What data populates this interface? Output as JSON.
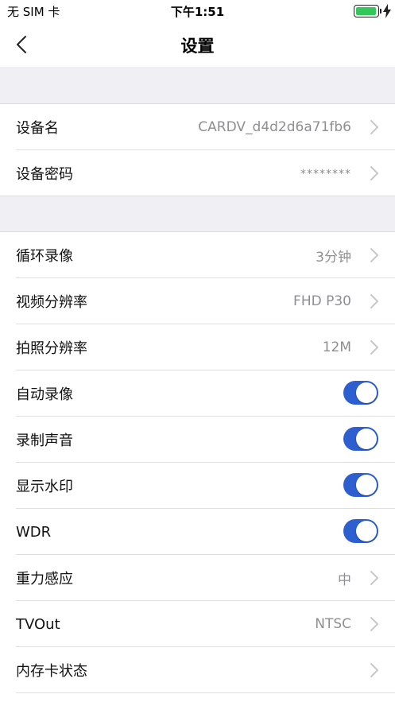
{
  "status_bar": {
    "carrier": "无 SIM 卡",
    "time": "下午1:51",
    "battery_level": 1.0,
    "battery_color": "#34c759"
  },
  "nav": {
    "back_icon": "chevron-left-icon",
    "title": "设置"
  },
  "device_group": [
    {
      "label": "设备名",
      "value": "CARDV_d4d2d6a71fb6"
    },
    {
      "label": "设备密码",
      "value": "********"
    }
  ],
  "settings_group": [
    {
      "label": "循环录像",
      "value": "3分钟",
      "kind": "chevron"
    },
    {
      "label": "视频分辨率",
      "value": "FHD P30",
      "kind": "chevron"
    },
    {
      "label": "拍照分辨率",
      "value": "12M",
      "kind": "chevron"
    },
    {
      "label": "自动录像",
      "kind": "toggle",
      "on": true
    },
    {
      "label": "录制声音",
      "kind": "toggle",
      "on": true
    },
    {
      "label": "显示水印",
      "kind": "toggle",
      "on": true
    },
    {
      "label": "WDR",
      "kind": "toggle",
      "on": true
    },
    {
      "label": "重力感应",
      "value": "中",
      "kind": "chevron"
    },
    {
      "label": "TVOut",
      "value": "NTSC",
      "kind": "chevron"
    },
    {
      "label": "内存卡状态",
      "value": "",
      "kind": "chevron"
    }
  ],
  "colors": {
    "toggle_on": "#2e5fd0",
    "section_bg": "#efeff4",
    "value_text": "#8e8e93",
    "chevron": "#c7c7cc"
  }
}
